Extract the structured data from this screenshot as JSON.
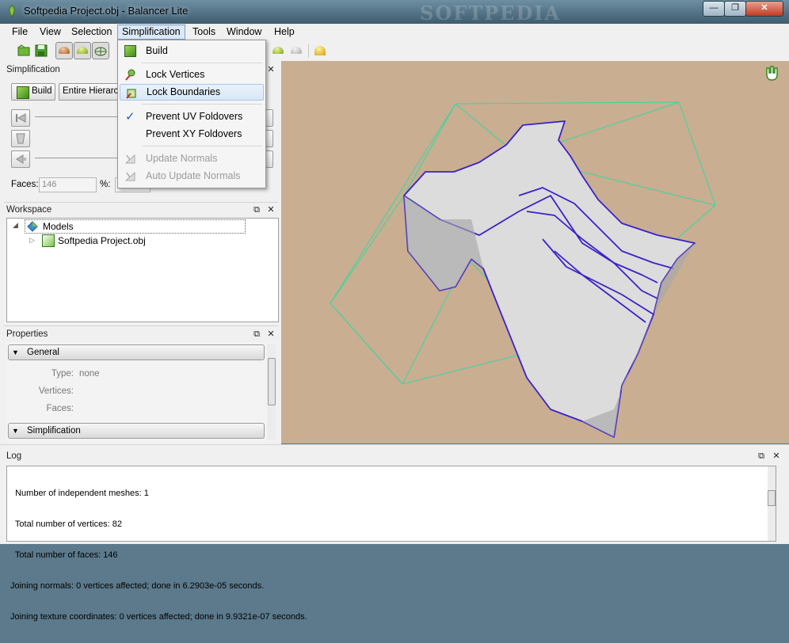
{
  "window": {
    "title": "Softpedia Project.obj - Balancer Lite",
    "watermark": "SOFTPEDIA",
    "controls": [
      "—",
      "❐",
      "✕"
    ]
  },
  "menubar": [
    "File",
    "View",
    "Selection",
    "Simplification",
    "Tools",
    "Window",
    "Help"
  ],
  "dropdown": {
    "build": "Build",
    "lock_vertices": "Lock Vertices",
    "lock_boundaries": "Lock Boundaries",
    "prevent_uv": "Prevent UV Foldovers",
    "prevent_xy": "Prevent XY Foldovers",
    "update_normals": "Update Normals",
    "auto_update_normals": "Auto Update Normals",
    "checkmark": "✓"
  },
  "simplification_panel": {
    "title": "Simplification",
    "build_button": "Build",
    "hierarchy_select": "Entire Hierarch",
    "faces_label": "Faces:",
    "faces_value": "146",
    "percent_label": "%:"
  },
  "workspace_panel": {
    "title": "Workspace",
    "tree": {
      "root": "Models",
      "child": "Softpedia Project.obj"
    }
  },
  "properties_panel": {
    "title": "Properties",
    "group_general": "General",
    "fields": [
      {
        "key": "Type:",
        "value": "none"
      },
      {
        "key": "Vertices:",
        "value": ""
      },
      {
        "key": "Faces:",
        "value": ""
      }
    ],
    "group_simplification": "Simplification"
  },
  "log_panel": {
    "title": "Log",
    "lines": [
      "  Number of independent meshes: 1",
      "  Total number of vertices: 82",
      "  Total number of faces: 146",
      "Joining normals: 0 vertices affected; done in 6.2903e-05 seconds.",
      "Joining texture coordinates: 0 vertices affected; done in 9.9321e-07 seconds."
    ]
  },
  "panel_buttons": {
    "float": "⧉",
    "close": "✕"
  },
  "colors": {
    "viewport_bg": "#c9ae92",
    "bbox": "#37d7a0",
    "edges": "#3a22c8",
    "mesh": "#dcdcdc",
    "menu_highlight": "#d8e7f7"
  }
}
